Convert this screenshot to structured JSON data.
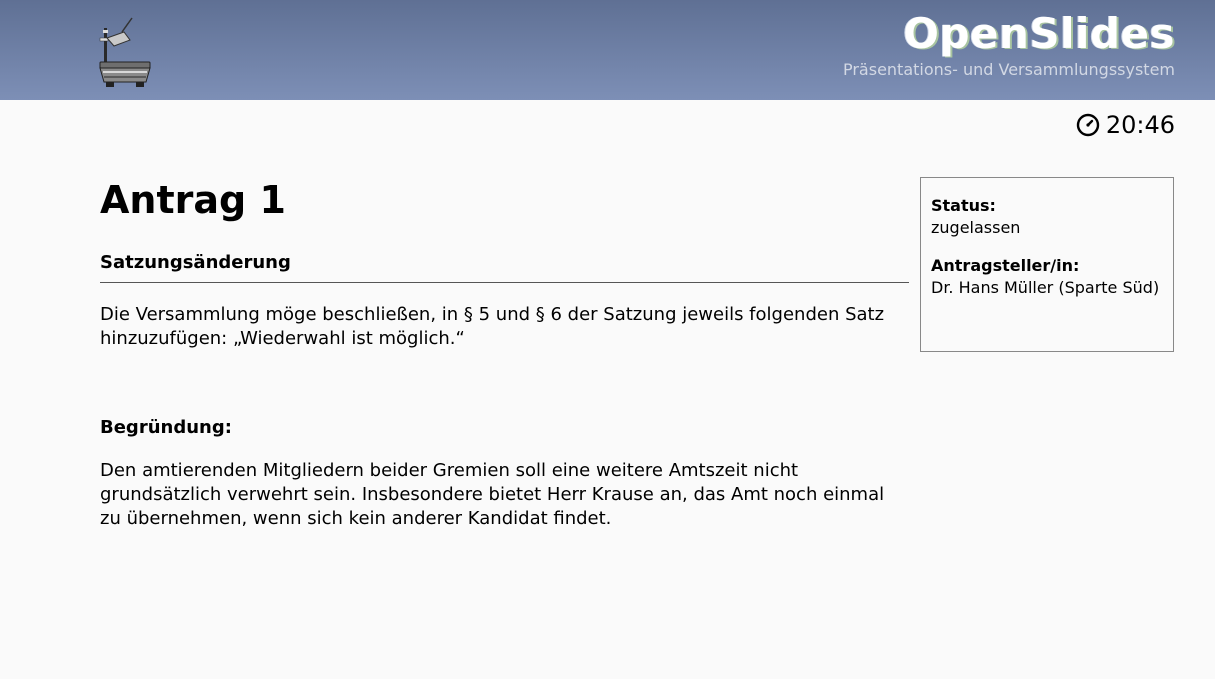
{
  "header": {
    "logo_icon": "overhead-projector-icon",
    "brand_title": "OpenSlides",
    "brand_subtitle": "Präsentations- und Versammlungssystem",
    "colors": {
      "header_gradient_top": "#5f7094",
      "header_gradient_bottom": "#7d8fb6"
    }
  },
  "clock": {
    "icon": "clock-icon",
    "time": "20:46"
  },
  "motion": {
    "title": "Antrag 1",
    "subtitle": "Satzungsänderung",
    "text": "Die Versammlung möge beschließen, in § 5 und § 6 der Satzung jeweils folgenden Satz hinzuzufügen: „Wiederwahl ist möglich.“",
    "reason_heading": "Begründung:",
    "reason_text": "Den amtierenden Mitgliedern beider Gremien soll eine weitere Amtszeit nicht grundsätzlich verwehrt sein. Insbesondere bietet Herr Krause an, das Amt noch einmal zu übernehmen, wenn sich kein anderer Kandidat findet."
  },
  "sidebar": {
    "status_label": "Status:",
    "status_value": "zugelassen",
    "submitter_label": "Antragsteller/in:",
    "submitter_value": "Dr. Hans Müller (Sparte Süd)"
  }
}
